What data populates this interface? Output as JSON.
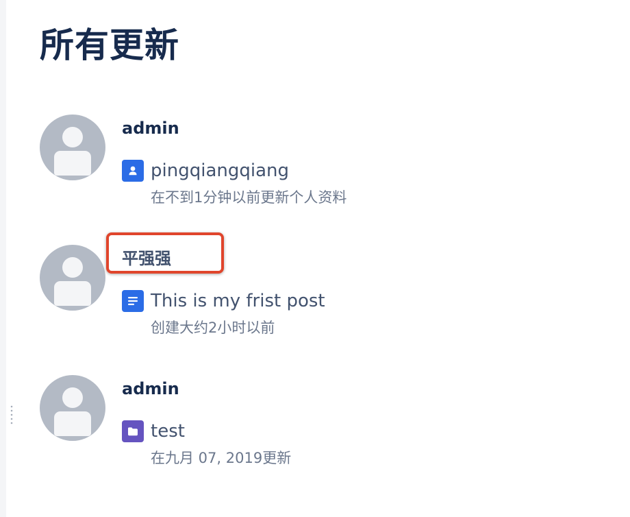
{
  "page_title": "所有更新",
  "colors": {
    "profile_icon_bg": "#2b6ce6",
    "page_icon_bg": "#2b6ce6",
    "space_icon_bg": "#6554c0",
    "highlight": "#e0452c"
  },
  "feed": [
    {
      "author": "admin",
      "content_icon": "user-profile-icon",
      "content_title": "pingqiangqiang",
      "meta": "在不到1分钟以前更新个人资料"
    },
    {
      "author": "平强强",
      "content_icon": "page-document-icon",
      "content_title": "This is my frist post",
      "meta": "创建大约2小时以前"
    },
    {
      "author": "admin",
      "content_icon": "folder-icon",
      "content_title": "test",
      "meta": "在九月 07, 2019更新"
    }
  ]
}
